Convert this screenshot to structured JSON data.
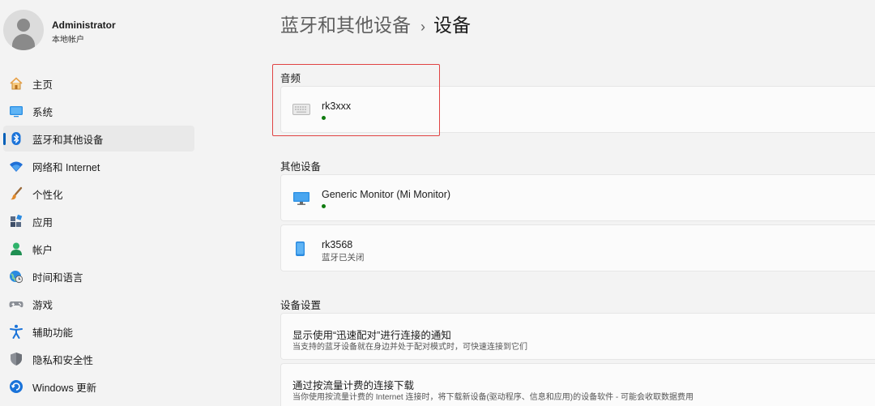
{
  "profile": {
    "name": "Administrator",
    "account_type": "本地帐户"
  },
  "nav": {
    "items": [
      {
        "label": "主页",
        "icon": "home-icon"
      },
      {
        "label": "系统",
        "icon": "monitor-icon"
      },
      {
        "label": "蓝牙和其他设备",
        "icon": "bluetooth-icon",
        "active": true
      },
      {
        "label": "网络和 Internet",
        "icon": "wifi-icon"
      },
      {
        "label": "个性化",
        "icon": "brush-icon"
      },
      {
        "label": "应用",
        "icon": "apps-icon"
      },
      {
        "label": "帐户",
        "icon": "account-icon"
      },
      {
        "label": "时间和语言",
        "icon": "globe-clock-icon"
      },
      {
        "label": "游戏",
        "icon": "gamepad-icon"
      },
      {
        "label": "辅助功能",
        "icon": "accessibility-icon"
      },
      {
        "label": "隐私和安全性",
        "icon": "shield-icon"
      },
      {
        "label": "Windows 更新",
        "icon": "update-icon"
      }
    ]
  },
  "breadcrumb": {
    "parent": "蓝牙和其他设备",
    "separator": "›",
    "current": "设备"
  },
  "audio": {
    "title": "音频",
    "device": {
      "name": "rk3xxx",
      "icon": "keyboard-icon",
      "status_color": "#0f7b0f"
    }
  },
  "other_devices": {
    "title": "其他设备",
    "devices": [
      {
        "name": "Generic Monitor (Mi Monitor)",
        "icon": "monitor-icon",
        "status_color": "#0f7b0f"
      },
      {
        "name": "rk3568",
        "icon": "phone-icon",
        "subtitle": "蓝牙已关闭"
      }
    ]
  },
  "device_settings": {
    "title": "设备设置",
    "items": [
      {
        "title": "显示使用“迅速配对”进行连接的通知",
        "description": "当支持的蓝牙设备就在身边并处于配对模式时，可快速连接到它们"
      },
      {
        "title": "通过按流量计费的连接下载",
        "description": "当你使用按流量计费的 Internet 连接时，将下载新设备(驱动程序、信息和应用)的设备软件 - 可能会收取数据费用"
      }
    ]
  },
  "colors": {
    "accent": "#005fb8",
    "highlight_border": "#e04343",
    "connected": "#0f7b0f"
  }
}
